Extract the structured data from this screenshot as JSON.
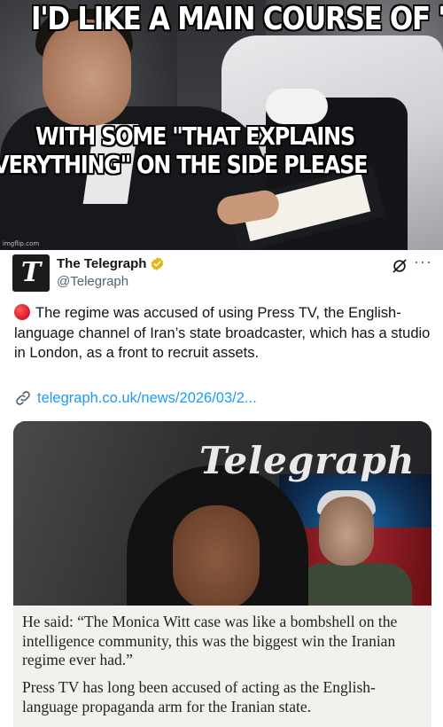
{
  "meme": {
    "caption_top": "I'D LIKE A MAIN COURSE OF \"DUH\"",
    "caption_bottom_line1": "WITH SOME \"THAT EXPLAINS",
    "caption_bottom_line2": "EVERYTHING\" ON THE SIDE PLEASE",
    "watermark": "imgflip.com"
  },
  "tweet": {
    "display_name": "The Telegraph",
    "handle": "@Telegraph",
    "avatar_letter": "T",
    "verified_color": "#e2b719",
    "icons": {
      "verified": "verified-badge-icon",
      "grok": "grok-icon",
      "more": "more-options-icon",
      "link": "link-icon",
      "bullet": "red-circle-emoji"
    },
    "more_glyph": "···",
    "text": "The regime was accused of using Press TV, the English-language channel of Iran’s state broadcaster, which has a studio in London, as a front to recruit assets.",
    "link_text": "telegraph.co.uk/news/2026/03/2...",
    "link_color": "#1d9bf0"
  },
  "media": {
    "masthead": "Telegraph",
    "quote_paragraph_1": "He said: “The Monica Witt case was like a bombshell on the intelligence community, this was the biggest win the Iranian regime ever had.”",
    "quote_paragraph_2": "Press TV has long been accused of acting as the English-language propaganda arm for the Iranian state."
  }
}
